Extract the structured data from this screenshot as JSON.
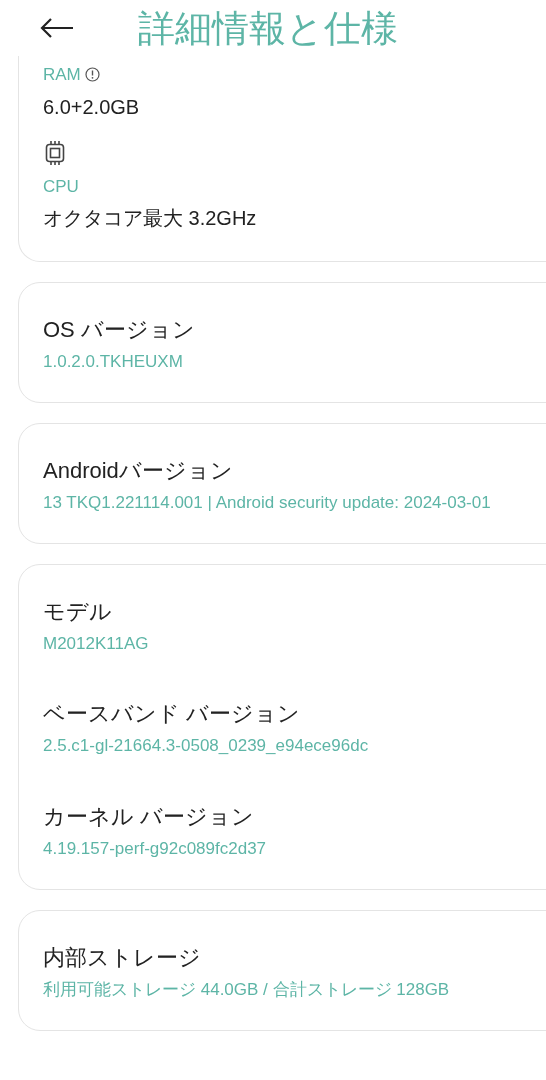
{
  "header": {
    "title": "詳細情報と仕様"
  },
  "spec_card": {
    "items": [
      {
        "kind": "ram",
        "label": "RAM",
        "value": "6.0+2.0GB"
      },
      {
        "kind": "cpu",
        "label": "CPU",
        "value": "オクタコア最大 3.2GHz"
      }
    ]
  },
  "cards": [
    {
      "items": [
        {
          "title": "OS バージョン",
          "value": "1.0.2.0.TKHEUXM"
        }
      ]
    },
    {
      "items": [
        {
          "title": "Androidバージョン",
          "value": "13 TKQ1.221114.001 | Android security update: 2024-03-01"
        }
      ]
    },
    {
      "items": [
        {
          "title": "モデル",
          "value": "M2012K11AG"
        },
        {
          "title": "ベースバンド バージョン",
          "value": "2.5.c1-gl-21664.3-0508_0239_e94ece96dc"
        },
        {
          "title": "カーネル バージョン",
          "value": "4.19.157-perf-g92c089fc2d37"
        }
      ]
    },
    {
      "items": [
        {
          "title": "内部ストレージ",
          "value": "利用可能ストレージ  44.0GB / 合計ストレージ 128GB"
        }
      ]
    }
  ]
}
